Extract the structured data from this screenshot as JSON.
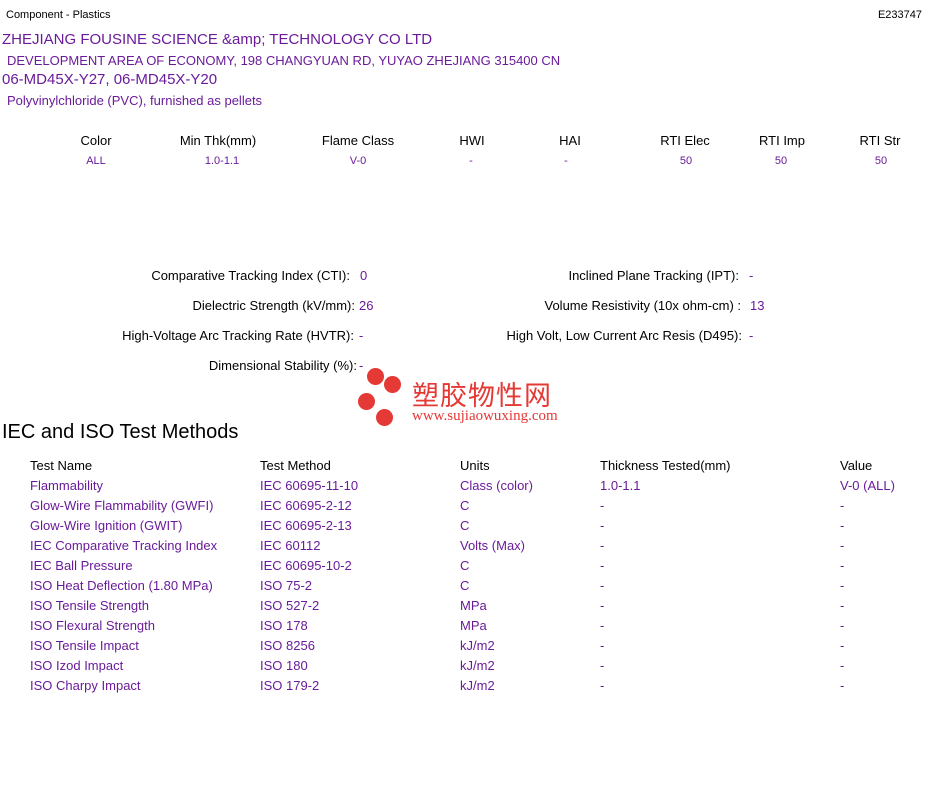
{
  "header": {
    "category": "Component - Plastics",
    "file_number": "E233747"
  },
  "company": {
    "name": "ZHEJIANG FOUSINE SCIENCE &amp; TECHNOLOGY CO LTD",
    "address": "DEVELOPMENT AREA OF ECONOMY, 198 CHANGYUAN RD, YUYAO  ZHEJIANG  315400 CN"
  },
  "product": {
    "models": "06-MD45X-Y27, 06-MD45X-Y20",
    "material": "Polyvinylchloride (PVC), furnished as pellets"
  },
  "ratings": {
    "headers": [
      "Color",
      "Min Thk(mm)",
      "Flame Class",
      "HWI",
      "HAI",
      "RTI Elec",
      "RTI Imp",
      "RTI Str"
    ],
    "values": [
      "ALL",
      "1.0-1.1",
      "V-0",
      "-",
      "-",
      "50",
      "50",
      "50"
    ]
  },
  "properties": {
    "left": [
      {
        "label": "Comparative Tracking Index (CTI):",
        "value": "0"
      },
      {
        "label": "Dielectric Strength (kV/mm):",
        "value": "26"
      },
      {
        "label": "High-Voltage Arc Tracking Rate (HVTR):",
        "value": "-"
      },
      {
        "label": "Dimensional Stability (%):",
        "value": "-"
      }
    ],
    "right": [
      {
        "label": "Inclined Plane Tracking (IPT):",
        "value": "-"
      },
      {
        "label": "Volume Resistivity (10x ohm-cm) :",
        "value": "13"
      },
      {
        "label": "High Volt, Low Current Arc Resis (D495):",
        "value": "-"
      }
    ]
  },
  "test_methods": {
    "title": "IEC and ISO Test Methods",
    "headers": [
      "Test Name",
      "Test Method",
      "Units",
      "Thickness Tested(mm)",
      "Value"
    ],
    "rows": [
      [
        "Flammability",
        "IEC 60695-11-10",
        "Class (color)",
        "1.0-1.1",
        "V-0 (ALL)"
      ],
      [
        "Glow-Wire Flammability (GWFI)",
        "IEC 60695-2-12",
        "C",
        "-",
        "-"
      ],
      [
        "Glow-Wire Ignition (GWIT)",
        "IEC 60695-2-13",
        "C",
        "-",
        "-"
      ],
      [
        "IEC Comparative Tracking Index",
        "IEC 60112",
        "Volts (Max)",
        "-",
        "-"
      ],
      [
        "IEC Ball Pressure",
        "IEC 60695-10-2",
        "C",
        "-",
        "-"
      ],
      [
        "ISO Heat Deflection (1.80 MPa)",
        "ISO 75-2",
        "C",
        "-",
        "-"
      ],
      [
        "ISO Tensile Strength",
        "ISO 527-2",
        "MPa",
        "-",
        "-"
      ],
      [
        "ISO Flexural Strength",
        "ISO 178",
        "MPa",
        "-",
        "-"
      ],
      [
        "ISO Tensile Impact",
        "ISO 8256",
        "kJ/m2",
        "-",
        "-"
      ],
      [
        "ISO Izod Impact",
        "ISO 180",
        "kJ/m2",
        "-",
        "-"
      ],
      [
        "ISO Charpy Impact",
        "ISO 179-2",
        "kJ/m2",
        "-",
        "-"
      ]
    ]
  },
  "watermark": {
    "cn_text": "塑胶物性网",
    "url": "www.sujiaowuxing.com"
  },
  "colors": {
    "accent_text": "#6a1b9a",
    "watermark": "#e53935"
  }
}
